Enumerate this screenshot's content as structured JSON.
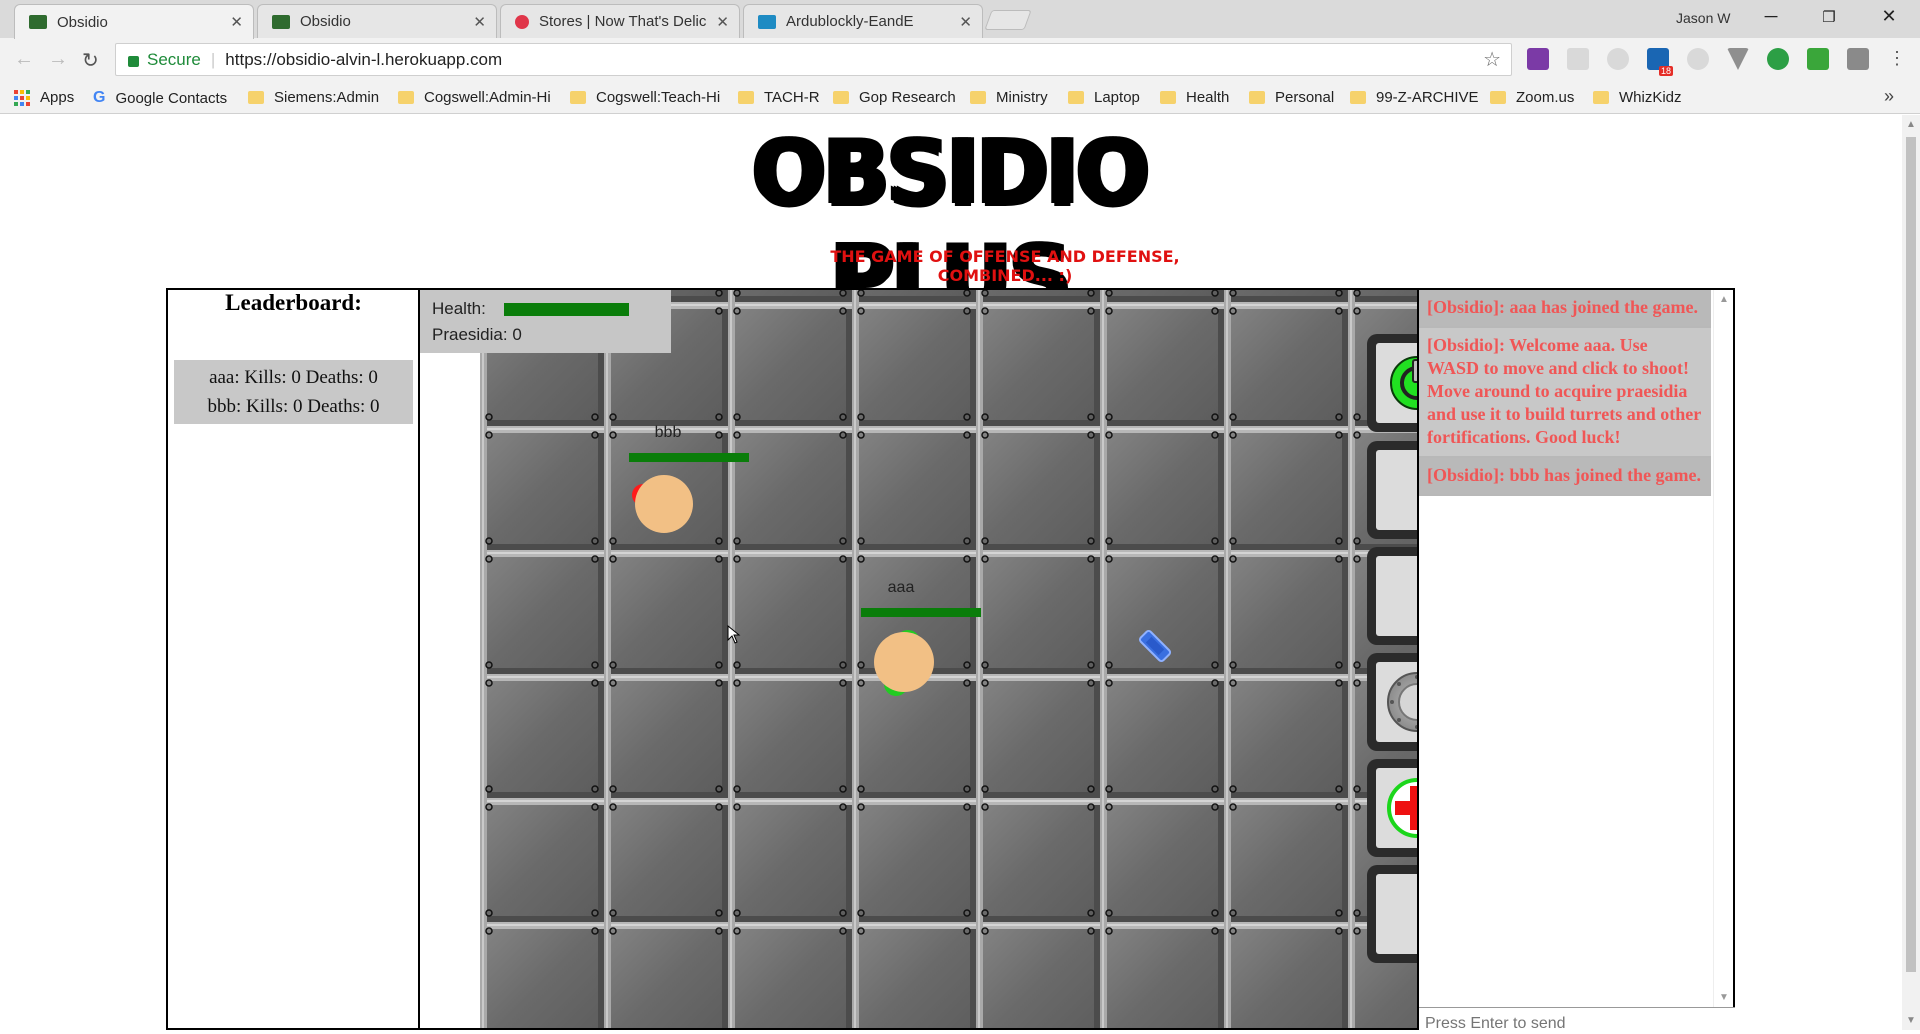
{
  "browser": {
    "tabs": [
      {
        "title": "Obsidio",
        "active": true,
        "favicon_color": "#2f6b2f"
      },
      {
        "title": "Obsidio",
        "active": false,
        "favicon_color": "#2f6b2f"
      },
      {
        "title": "Stores | Now That's Delic",
        "active": false,
        "favicon_color": "#e0364a"
      },
      {
        "title": "Ardublockly-EandE",
        "active": false,
        "favicon_color": "#1e8bc3"
      }
    ],
    "profile_name": "Jason W",
    "secure_label": "Secure",
    "url": "https://obsidio-alvin-l.herokuapp.com",
    "bookmarks": [
      "Apps",
      "Google Contacts",
      "Siemens:Admin",
      "Cogswell:Admin-Hi",
      "Cogswell:Teach-Hi",
      "TACH-R",
      "Gop Research",
      "Ministry",
      "Laptop",
      "Health",
      "Personal",
      "99-Z-ARCHIVE",
      "Zoom.us",
      "WhizKidz"
    ],
    "extension_badge": "18"
  },
  "page": {
    "title": "OBSIDIO PLUS",
    "subtitle": "THE GAME OF OFFENSE AND DEFENSE, COMBINED... :)"
  },
  "leaderboard": {
    "title": "Leaderboard:",
    "entries": [
      "aaa: Kills: 0 Deaths: 0",
      "bbb: Kills: 0 Deaths: 0"
    ]
  },
  "hud": {
    "health_label": "Health:",
    "health_fraction": 1.0,
    "praesidia_text": "Praesidia: 0"
  },
  "players": [
    {
      "name": "bbb",
      "team_color": "#ff1a1a",
      "health_fraction": 1.0
    },
    {
      "name": "aaa",
      "team_color": "#22cc22",
      "health_fraction": 1.0
    }
  ],
  "build_menu": {
    "slots": [
      "power-button",
      "empty",
      "empty",
      "turret-wall",
      "health-pack",
      "empty"
    ]
  },
  "chat": {
    "messages": [
      "[Obsidio]: aaa has joined the game.",
      "[Obsidio]: Welcome aaa. Use WASD to move and click to shoot! Move around to acquire praesidia and use it to build turrets and other fortifications. Good luck!",
      "[Obsidio]: bbb has joined the game."
    ],
    "input_placeholder": "Press Enter to send"
  },
  "colors": {
    "health_green": "#0a7d0a",
    "chat_text": "#f05656",
    "subtitle_red": "#e01010",
    "floor": "#6f6f6f"
  }
}
